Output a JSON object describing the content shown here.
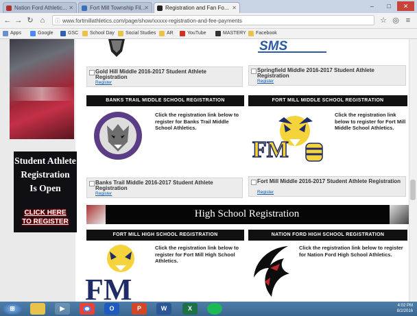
{
  "browser": {
    "tabs": [
      {
        "title": "Nation Ford Athletic...",
        "active": false
      },
      {
        "title": "Fort Mill Township Fil...",
        "active": false
      },
      {
        "title": "Registration and Fan Fo...",
        "active": true
      }
    ],
    "url": "www.fortmillathletics.com/page/show/xxxxx-registration-and-fee-payments",
    "bookmarks": [
      "Apps",
      "Google",
      "GSC",
      "School Day",
      "Social Studies",
      "AR",
      "YouTube",
      "MASTERY",
      "Facebook"
    ]
  },
  "sidebar": {
    "ad_lines": [
      "Student Athlete",
      "Registration",
      "Is Open"
    ],
    "ad_cta_lines": [
      "CLICK HERE",
      "TO REGISTER"
    ]
  },
  "middle_schools": {
    "top_cards": [
      {
        "title": "Gold Hill Middle 2016-2017 Student Athlete Registration",
        "link": "Register"
      },
      {
        "title": "Springfield Middle 2016-2017 Student Athlete Registration",
        "link": "Register"
      }
    ],
    "sections": [
      {
        "header": "BANKS TRAIL MIDDLE SCHOOL REGISTRATION",
        "description": "Click the registration link below to register for Banks Trail Middle School Athletics.",
        "card_title": "Banks Trail Middle 2016-2017 Student Athlete Registration",
        "card_link": "Register"
      },
      {
        "header": "FORT MILL MIDDLE SCHOOL REGISTRATION",
        "description": "Click the registration link below to register for Fort Mill Middle School Athletics.",
        "card_title": "Fort Mill Middle 2016-2017 Student Athlete Registration",
        "card_link": "Register"
      }
    ]
  },
  "high_schools": {
    "banner_title": "High School Registration",
    "sections": [
      {
        "header": "FORT MILL HIGH SCHOOL REGISTRATION",
        "description": "Click the registration link below to register for Fort Mill High School Athletics."
      },
      {
        "header": "NATION FORD HIGH SCHOOL REGISTRATION",
        "description": "Click the registration link below to register for Nation Ford High School Athletics."
      }
    ]
  },
  "taskbar": {
    "apps": [
      "start",
      "explorer",
      "media",
      "chrome",
      "outlook",
      "powerpoint",
      "word",
      "excel",
      "spotify"
    ],
    "clock_time": "4:02 PM",
    "clock_date": "8/2/2016"
  }
}
